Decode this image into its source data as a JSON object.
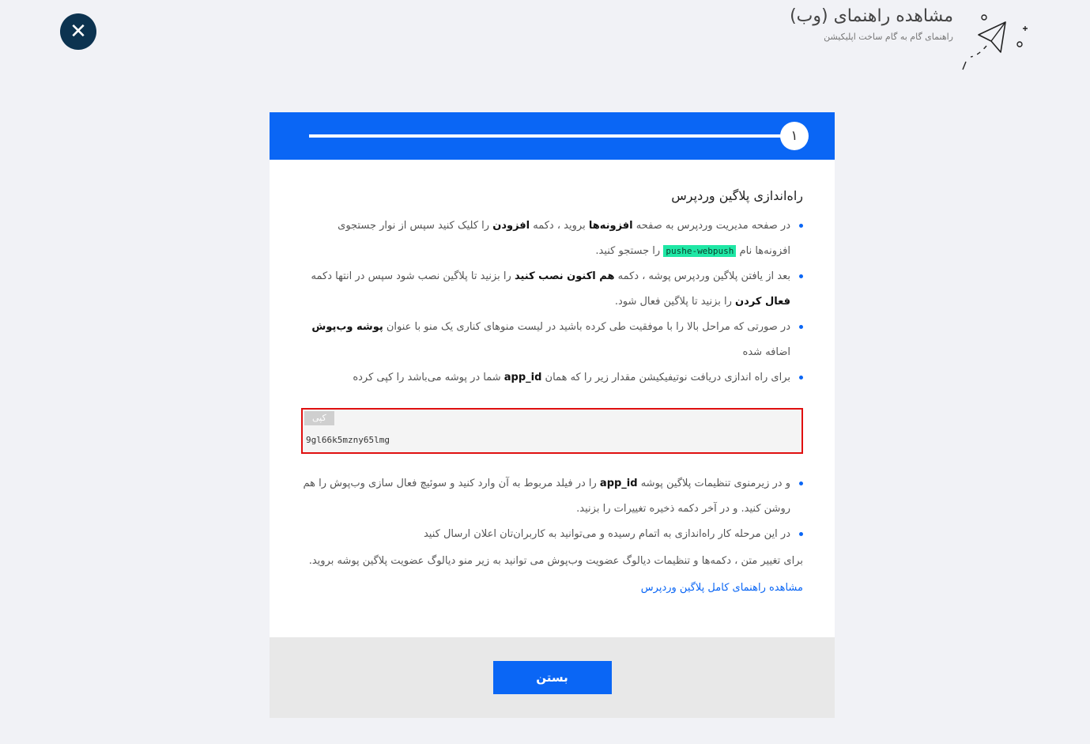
{
  "header": {
    "title": "مشاهده راهنمای (وب)",
    "subtitle": "راهنمای گام به گام ساخت اپلیکیشن",
    "close_icon": "close-icon",
    "illustration_icon": "paper-plane-icon"
  },
  "progress": {
    "step_label": "۱"
  },
  "section": {
    "title": "راه‌اندازی پلاگین وردپرس",
    "items": [
      {
        "p1": "در صفحه مدیریت وردپرس به صفحه ",
        "b1": "افزونه‌ها",
        "p2": " بروید ، دکمه ",
        "b2": "افزودن",
        "p3": " را کلیک کنید سپس از نوار جستجوی افزونه‌ها نام ",
        "tag": "pushe-webpush",
        "p4": " را جستجو کنید."
      },
      {
        "p1": "بعد از یافتن پلاگین وردپرس پوشه ، دکمه ",
        "b1": "هم اکنون نصب کنید",
        "p2": " را بزنید تا پلاگین نصب شود سپس در انتها دکمه ",
        "b2": "فعال کردن",
        "p3": " را بزنید تا پلاگین فعال شود."
      },
      {
        "p1": "در صورتی که مراحل بالا را با موفقیت طی کرده باشید در لیست منوهای کناری یک منو با عنوان ",
        "b1": "پوشه وب‌پوش",
        "p2": " اضافه شده"
      },
      {
        "p1": "برای راه اندازی دریافت نوتیفیکیشن مقدار زیر را که همان ",
        "b1": "app_id",
        "p2": " شما در پوشه می‌باشد را کپی کرده"
      }
    ],
    "copy_label": "کپی",
    "app_id": "9gl66k5mzny65lmg",
    "items2": [
      {
        "p1": "و در زیرمنوی تنظیمات پلاگین پوشه ",
        "b1": "app_id",
        "p2": " را در فیلد مربوط به آن وارد کنید و سوئیچ فعال سازی وب‌پوش را هم روشن کنید. و در آخر دکمه ذخیره تغییرات را بزنید."
      },
      {
        "p1": "در این مرحله کار راه‌اندازی به اتمام رسیده و می‌توانید به کاربران‌تان اعلان ارسال کنید"
      }
    ],
    "note": "برای تغییر متن ، دکمه‌ها و تنظیمات دیالوگ عضویت وب‌پوش می توانید به زیر منو دیالوگ عضویت پلاگین پوشه بروید.",
    "guide_link": "مشاهده راهنمای کامل پلاگین وردپرس"
  },
  "footer": {
    "close_label": "بستن"
  },
  "colors": {
    "accent": "#0a66f5",
    "dark": "#0c3350",
    "highlight": "#1fe7a5",
    "error_border": "#e01010"
  }
}
